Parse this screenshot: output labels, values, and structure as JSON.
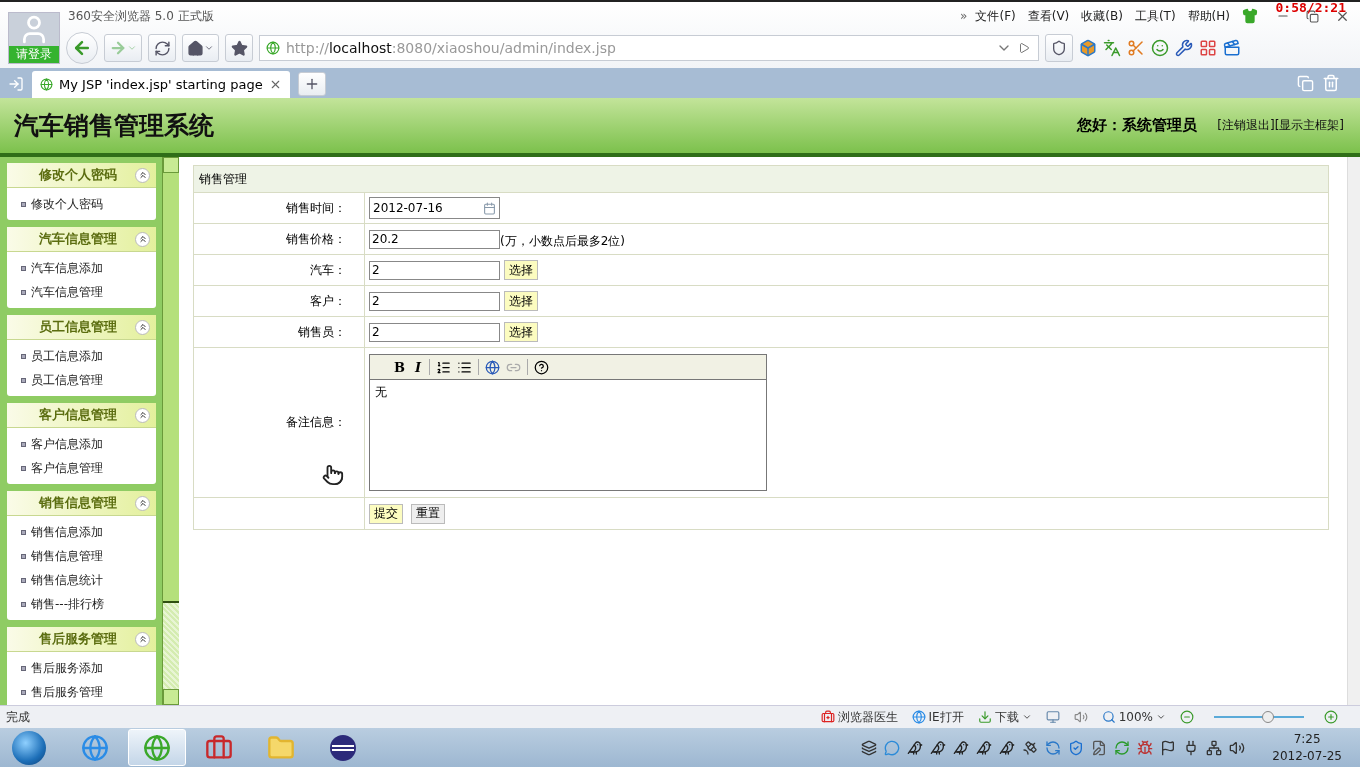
{
  "browser": {
    "login_button": "请登录",
    "title": "360安全浏览器 5.0 正式版",
    "menu_more": "»",
    "menu": [
      "文件(F)",
      "查看(V)",
      "收藏(B)",
      "工具(T)",
      "帮助(H)"
    ],
    "recorder_time": "0:58/2:21",
    "address": {
      "scheme": "http://",
      "host": "localhost",
      "path": ":8080/xiaoshou/admin/index.jsp"
    },
    "tabs": [
      {
        "label": "My JSP 'index.jsp' starting page",
        "selected": true
      }
    ]
  },
  "page": {
    "title": "汽车销售管理系统",
    "greeting": "您好：系统管理员",
    "links": [
      "[注销退出]",
      "[显示主框架]"
    ]
  },
  "sidebar": {
    "groups": [
      {
        "title": "修改个人密码",
        "expanded": true,
        "items": [
          "修改个人密码"
        ]
      },
      {
        "title": "汽车信息管理",
        "expanded": true,
        "items": [
          "汽车信息添加",
          "汽车信息管理"
        ]
      },
      {
        "title": "员工信息管理",
        "expanded": true,
        "items": [
          "员工信息添加",
          "员工信息管理"
        ]
      },
      {
        "title": "客户信息管理",
        "expanded": true,
        "items": [
          "客户信息添加",
          "客户信息管理"
        ]
      },
      {
        "title": "销售信息管理",
        "expanded": true,
        "items": [
          "销售信息添加",
          "销售信息管理",
          "销售信息统计",
          "销售---排行榜"
        ]
      },
      {
        "title": "售后服务管理",
        "expanded": true,
        "items": [
          "售后服务添加",
          "售后服务管理"
        ]
      }
    ]
  },
  "form": {
    "title": "销售管理",
    "rows": [
      {
        "kind": "date",
        "label": "销售时间：",
        "value": "2012-07-16"
      },
      {
        "kind": "text",
        "label": "销售价格：",
        "value": "20.2",
        "note": "(万，小数点后最多2位)"
      },
      {
        "kind": "pick",
        "label": "汽车：",
        "value": "2",
        "button": "选择"
      },
      {
        "kind": "pick",
        "label": "客户：",
        "value": "2",
        "button": "选择"
      },
      {
        "kind": "pick",
        "label": "销售员：",
        "value": "2",
        "button": "选择"
      },
      {
        "kind": "editor",
        "label": "备注信息：",
        "value": "无",
        "toolbar": [
          "B",
          "I"
        ]
      }
    ],
    "buttons": [
      {
        "label": "提交",
        "kind": "primary"
      },
      {
        "label": "重置",
        "kind": "plain"
      }
    ]
  },
  "status_bar": {
    "text": "完成",
    "items": [
      "浏览器医生",
      "IE打开",
      "下载"
    ],
    "zoom": "100%",
    "level": 0.6
  },
  "taskbar": {
    "apps": [
      {
        "kind": "ie",
        "selected": false
      },
      {
        "kind": "browser360",
        "selected": true
      },
      {
        "kind": "toolbox",
        "selected": false
      },
      {
        "kind": "folder",
        "selected": false
      },
      {
        "kind": "eclipse",
        "selected": false
      }
    ],
    "time": "7:25",
    "date": "2012-07-25"
  }
}
